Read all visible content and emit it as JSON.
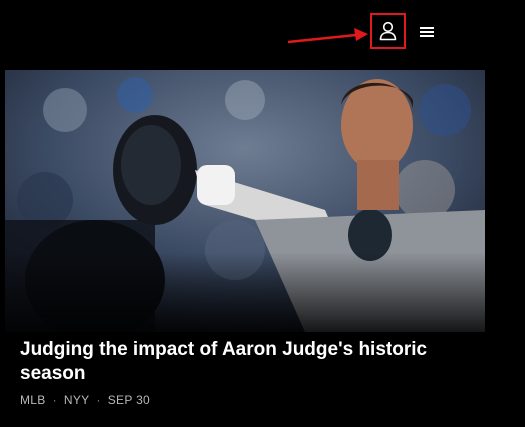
{
  "header": {
    "account_icon": "user-icon",
    "menu_icon": "hamburger-menu-icon",
    "highlight_color": "#e0191c"
  },
  "article": {
    "headline": "Judging the impact of Aaron Judge's historic season",
    "league": "MLB",
    "team": "NYY",
    "date": "SEP 30",
    "separator": "·"
  }
}
